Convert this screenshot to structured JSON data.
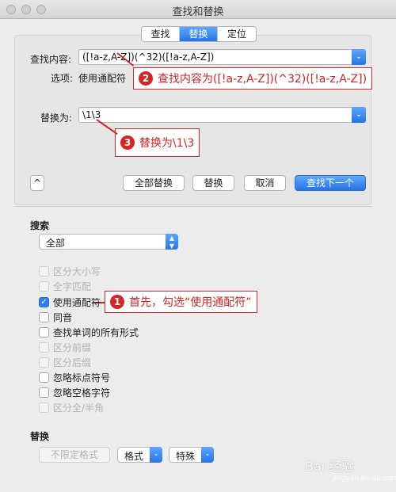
{
  "window": {
    "title": "查找和替换"
  },
  "tabs": [
    {
      "label": "查找",
      "active": false
    },
    {
      "label": "替换",
      "active": true
    },
    {
      "label": "定位",
      "active": false
    }
  ],
  "find": {
    "label": "查找内容:",
    "value": "([!a-z,A-Z])(^32)([!a-z,A-Z])"
  },
  "options": {
    "label": "选项:",
    "value": "使用通配符"
  },
  "replace": {
    "label": "替换为:",
    "value": "\\1\\3"
  },
  "annotations": {
    "step2": {
      "number": "2",
      "text": "查找内容为([!a-z,A-Z])(^32)([!a-z,A-Z])"
    },
    "step3": {
      "number": "3",
      "text": "替换为\\1\\3"
    },
    "step1": {
      "number": "1",
      "text": "首先，勾选“使用通配符”"
    },
    "color": "#d32424"
  },
  "buttons": {
    "expand_icon": "chevron-up-icon",
    "expand": "^",
    "replace_all": "全部替换",
    "replace": "替换",
    "cancel": "取消",
    "find_next": "查找下一个"
  },
  "search": {
    "label": "搜索",
    "scope": "全部",
    "options": [
      {
        "label": "区分大小写",
        "checked": false,
        "enabled": false
      },
      {
        "label": "全字匹配",
        "checked": false,
        "enabled": false
      },
      {
        "label": "使用通配符",
        "checked": true,
        "enabled": true
      },
      {
        "label": "同音",
        "checked": false,
        "enabled": true
      },
      {
        "label": "查找单词的所有形式",
        "checked": false,
        "enabled": true
      },
      {
        "label": "区分前缀",
        "checked": false,
        "enabled": false
      },
      {
        "label": "区分后缀",
        "checked": false,
        "enabled": false
      },
      {
        "label": "忽略标点符号",
        "checked": false,
        "enabled": true
      },
      {
        "label": "忽略空格字符",
        "checked": false,
        "enabled": true
      },
      {
        "label": "区分全/半角",
        "checked": false,
        "enabled": false
      }
    ]
  },
  "replace_section": {
    "label": "替换",
    "no_format": "不限定格式",
    "format": "格式",
    "special": "特殊"
  },
  "watermark": {
    "brand": "Bai 经验",
    "sub": "jingyan.baidu.com"
  },
  "colors": {
    "accent": "#2574e6"
  }
}
